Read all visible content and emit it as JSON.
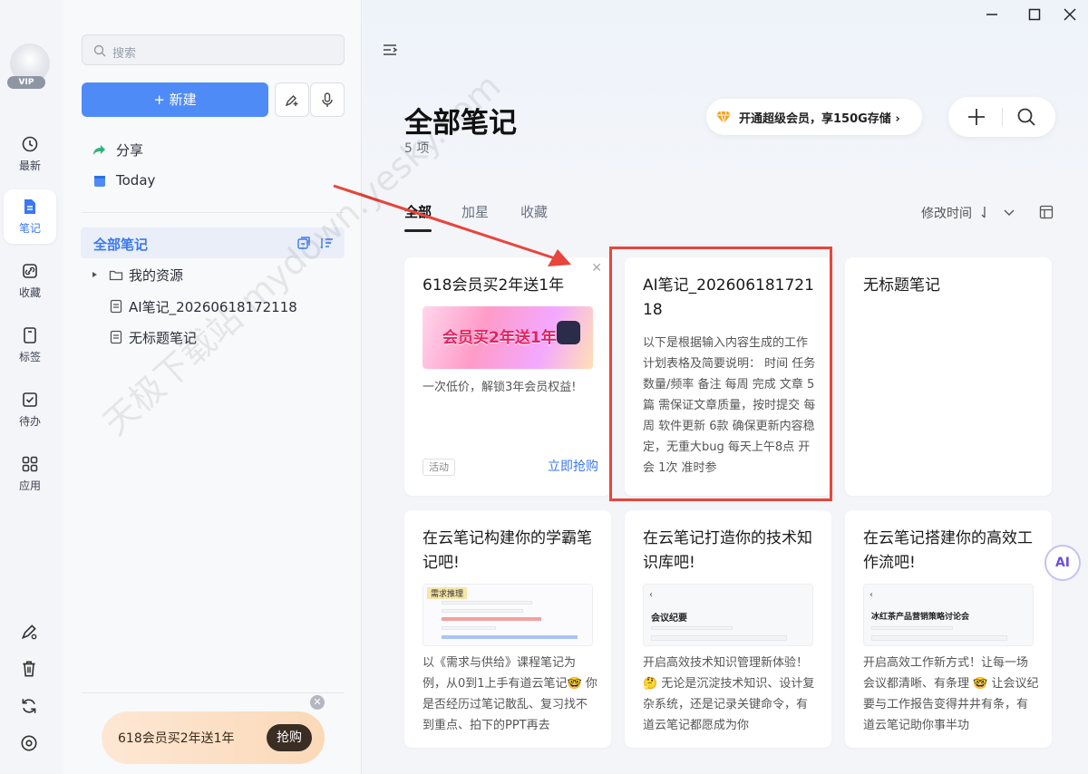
{
  "window": {
    "minimize": "—",
    "maximize": "☐",
    "close": "✕"
  },
  "rail": {
    "vip_badge": "VIP",
    "items": [
      {
        "label": "最新",
        "icon": "clock-icon"
      },
      {
        "label": "笔记",
        "icon": "note-icon",
        "active": true
      },
      {
        "label": "收藏",
        "icon": "bookmark-link-icon"
      },
      {
        "label": "标签",
        "icon": "tag-icon"
      },
      {
        "label": "待办",
        "icon": "checkbox-icon"
      },
      {
        "label": "应用",
        "icon": "apps-grid-icon"
      }
    ],
    "bottom_icons": [
      "pen-settings-icon",
      "trash-icon",
      "sync-icon",
      "settings-icon"
    ]
  },
  "sidebar": {
    "search_placeholder": "搜索",
    "new_button": "+ 新建",
    "quick": [
      {
        "label": "分享",
        "icon": "share-icon"
      },
      {
        "label": "Today",
        "icon": "today-icon"
      }
    ],
    "tree_head": "全部笔记",
    "tree": [
      {
        "label": "我的资源",
        "type": "folder"
      },
      {
        "label": "AI笔记_20260618172118",
        "type": "doc"
      },
      {
        "label": "无标题笔记",
        "type": "doc"
      }
    ],
    "promo_text": "618会员买2年送1年",
    "promo_button": "抢购"
  },
  "main": {
    "title": "全部笔记",
    "count": "5 项",
    "vip_banner": "开通超级会员，享150G存储 ›",
    "tabs": [
      "全部",
      "加星",
      "收藏"
    ],
    "sort_label": "修改时间"
  },
  "cards": [
    {
      "title": "618会员买2年送1年",
      "banner": "会员买2年送1年",
      "body": "一次低价，解锁3年会员权益!",
      "tag": "活动",
      "action": "立即抢购"
    },
    {
      "title": "AI笔记_20260618172118",
      "body": "以下是根据输入内容生成的工作计划表格及简要说明： 时间 任务 数量/频率 备注 每周 完成 文章 5篇 需保证文章质量，按时提交 每周 软件更新 6款 确保更新内容稳定，无重大bug 每天上午8点 开会 1次 准时参"
    },
    {
      "title": "无标题笔记"
    },
    {
      "title": "在云笔记构建你的学霸笔记吧!",
      "thumb_head": "需求推理",
      "body": "以《需求与供给》课程笔记为例，从0到1上手有道云笔记🤓 你是否经历过笔记散乱、复习找不到重点、拍下的PPT再去"
    },
    {
      "title": "在云笔记打造你的技术知识库吧!",
      "thumb_head": "会议纪要",
      "body": "开启高效技术知识管理新体验！ 🤔 无论是沉淀技术知识、设计复杂系统，还是记录关键命令，有道云笔记都愿成为你"
    },
    {
      "title": "在云笔记搭建你的高效工作流吧!",
      "thumb_head": "冰红茶产品营销策略讨论会",
      "body": "开启高效工作新方式！让每一场会议都清晰、有条理 🤓 让会议纪要与工作报告变得井井有条，有道云笔记助你事半功"
    }
  ],
  "ai_button": "AI",
  "watermark": "天极下载站 mydown.yesky.com",
  "colors": {
    "accent": "#4f8bf7",
    "annotation": "#e8453c"
  }
}
